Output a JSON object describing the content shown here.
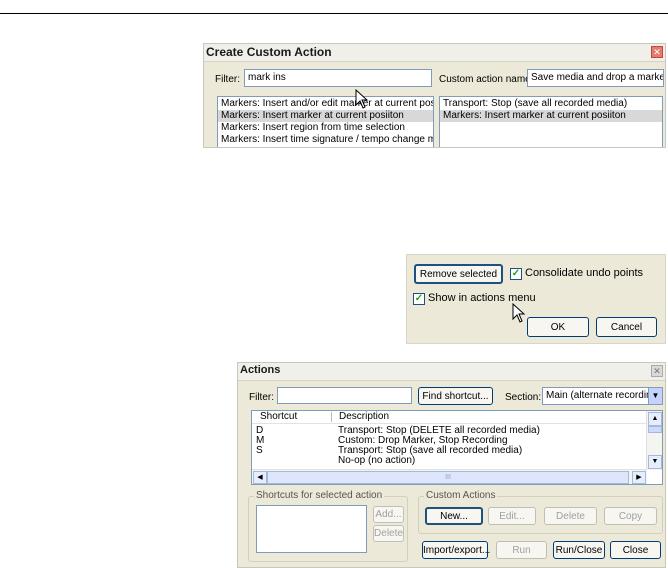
{
  "create_dialog": {
    "title": "Create Custom Action",
    "close_glyph": "✕",
    "filter_label": "Filter:",
    "filter_value": "mark ins",
    "name_label": "Custom action name:",
    "name_value": "Save media and drop a marker",
    "available_actions": [
      "Markers: Insert and/or edit marker at current positio",
      "Markers: Insert marker at current posiiton",
      "Markers: Insert region from time selection",
      "Markers: Insert time signature / tempo change mark"
    ],
    "selected_actions": [
      "Transport: Stop (save all recorded media)",
      "Markers: Insert marker at current posiiton"
    ]
  },
  "options_panel": {
    "remove_selected": "Remove selected",
    "consolidate_undo": "Consolidate undo points",
    "show_in_menu": "Show in actions menu",
    "ok": "OK",
    "cancel": "Cancel",
    "check_glyph": "✓"
  },
  "actions_dialog": {
    "title": "Actions",
    "close_glyph": "✕",
    "filter_label": "Filter:",
    "filter_value": "",
    "find_shortcut": "Find shortcut...",
    "section_label": "Section:",
    "section_value": "Main (alternate recording)",
    "columns": {
      "shortcut": "Shortcut",
      "description": "Description"
    },
    "rows": [
      {
        "shortcut": "D",
        "description": "Transport: Stop (DELETE all recorded media)"
      },
      {
        "shortcut": "M",
        "description": "Custom: Drop Marker, Stop Recording"
      },
      {
        "shortcut": "S",
        "description": "Transport: Stop (save all recorded media)"
      },
      {
        "shortcut": "",
        "description": "No-op (no action)"
      }
    ],
    "hscroll_grip": "III",
    "shortcuts_group": "Shortcuts for selected action",
    "add": "Add...",
    "delete": "Delete",
    "custom_group": "Custom Actions",
    "new": "New...",
    "edit": "Edit...",
    "delete_custom": "Delete",
    "copy": "Copy",
    "import_export": "Import/export...",
    "run": "Run",
    "run_close": "Run/Close",
    "close": "Close"
  }
}
